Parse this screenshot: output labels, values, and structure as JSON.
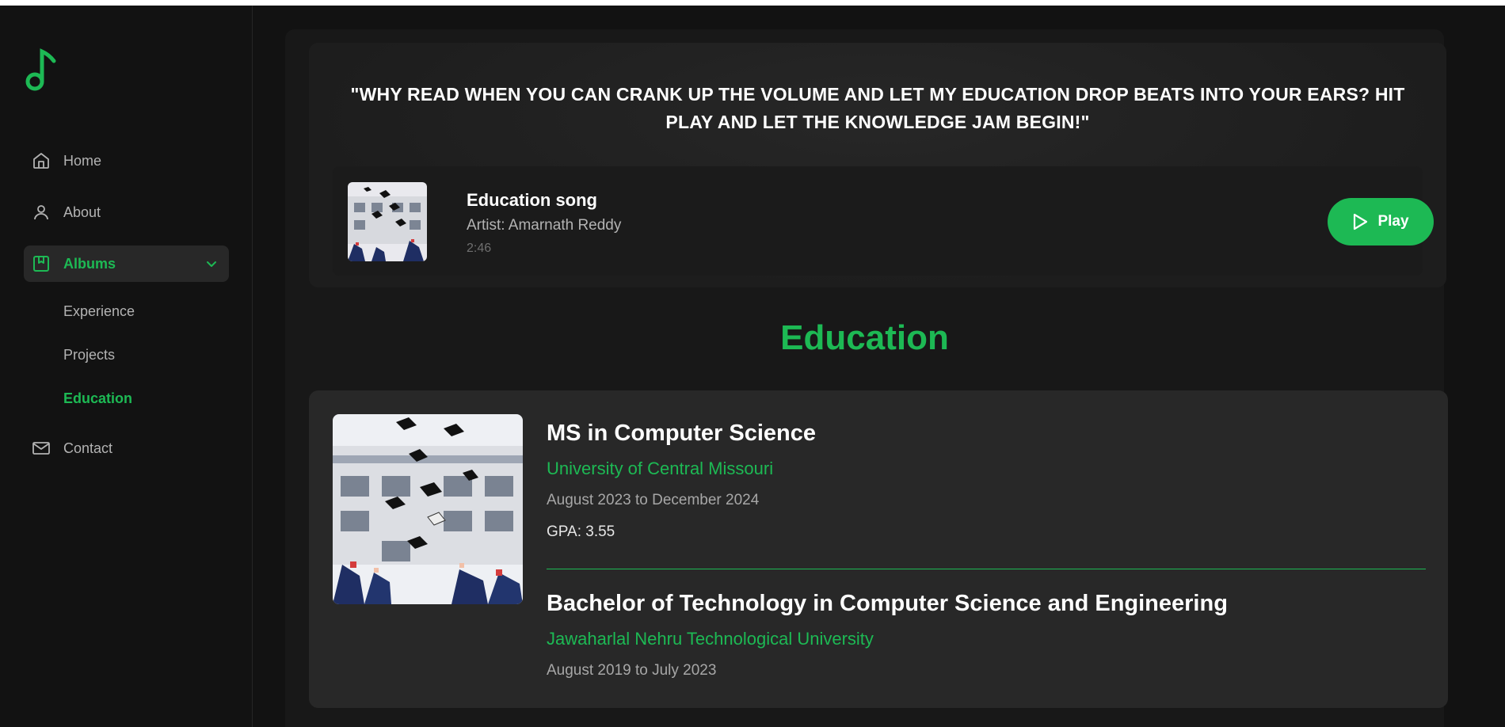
{
  "sidebar": {
    "logo_icon": "music-note-icon",
    "items": [
      {
        "label": "Home",
        "icon": "home-icon"
      },
      {
        "label": "About",
        "icon": "user-icon"
      },
      {
        "label": "Albums",
        "icon": "album-icon",
        "expanded": true,
        "children": [
          {
            "label": "Experience"
          },
          {
            "label": "Projects"
          },
          {
            "label": "Education",
            "active": true
          }
        ]
      },
      {
        "label": "Contact",
        "icon": "mail-icon"
      }
    ]
  },
  "hero": {
    "quote": "\"WHY READ WHEN YOU CAN CRANK UP THE VOLUME AND LET MY EDUCATION DROP BEATS INTO YOUR EARS? HIT PLAY AND LET THE KNOWLEDGE JAM BEGIN!\"",
    "song": {
      "title": "Education song",
      "artist": "Artist: Amarnath Reddy",
      "duration": "2:46",
      "play_label": "Play"
    }
  },
  "education": {
    "heading": "Education",
    "entries": [
      {
        "degree": "MS in Computer Science",
        "school": "University of Central Missouri",
        "dates": "August 2023 to December 2024",
        "gpa": "GPA: 3.55"
      },
      {
        "degree": "Bachelor of Technology in Computer Science and Engineering",
        "school": "Jawaharlal Nehru Technological University",
        "dates": "August 2019 to July 2023"
      }
    ]
  },
  "colors": {
    "accent": "#1db954",
    "background": "#121212",
    "card": "#282828"
  }
}
